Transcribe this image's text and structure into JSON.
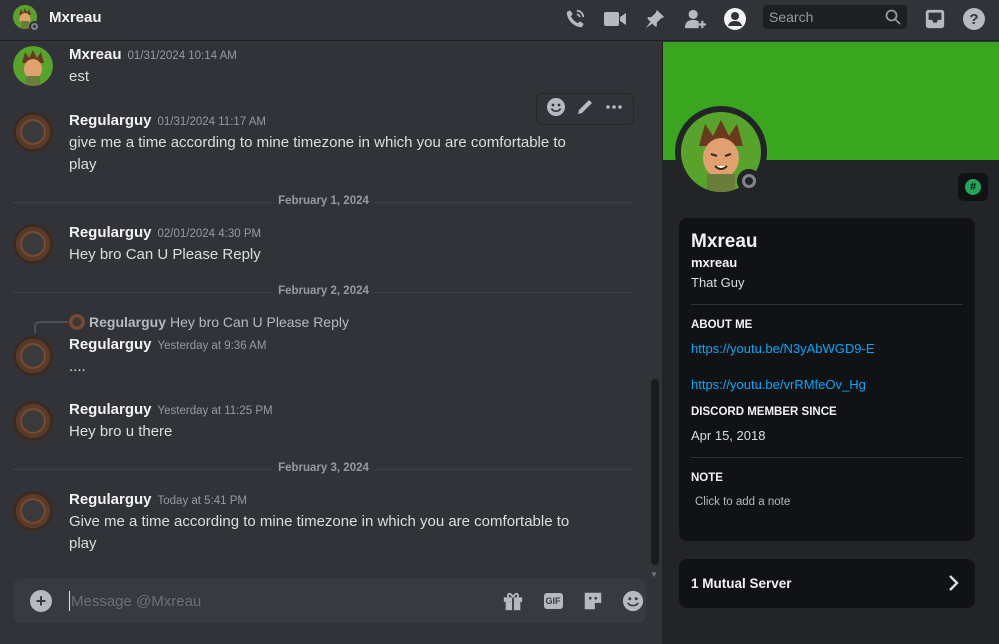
{
  "header": {
    "title": "Mxreau",
    "search_placeholder": "Search"
  },
  "messages": [
    {
      "username": "Mxreau",
      "timestamp": "01/31/2024 10:14 AM",
      "text": "est",
      "avatar": "green-cartoon-avatar"
    },
    {
      "username": "Regularguy",
      "timestamp": "01/31/2024 11:17 AM",
      "text": "give me a time according to mine timezone in which you are comfortable to play",
      "avatar": "dark-circle-avatar"
    },
    {
      "username": "Regularguy",
      "timestamp": "02/01/2024 4:30 PM",
      "text": "Hey bro Can U Please Reply",
      "avatar": "dark-circle-avatar"
    },
    {
      "username": "Regularguy",
      "timestamp": "Yesterday at 9:36 AM",
      "text": "....",
      "avatar": "dark-circle-avatar"
    },
    {
      "username": "Regularguy",
      "timestamp": "Yesterday at 11:25 PM",
      "text": "Hey bro u there",
      "avatar": "dark-circle-avatar"
    },
    {
      "username": "Regularguy",
      "timestamp": "Today at 5:41 PM",
      "text": "Give me a time according to mine timezone in which you are comfortable to play",
      "avatar": "dark-circle-avatar"
    }
  ],
  "dividers": [
    "February 1, 2024",
    "February 2, 2024",
    "February 3, 2024"
  ],
  "reply": {
    "username": "Regularguy",
    "text": "Hey bro Can U Please Reply"
  },
  "composer": {
    "placeholder": "Message @Mxreau",
    "gif_label": "GIF"
  },
  "profile": {
    "display_name": "Mxreau",
    "username": "mxreau",
    "custom_status": "That Guy",
    "about_title": "ABOUT ME",
    "links": [
      "https://youtu.be/N3yAbWGD9-E",
      "https://youtu.be/vrRMfeOv_Hg"
    ],
    "member_since_title": "DISCORD MEMBER SINCE",
    "member_since": "Apr 15, 2018",
    "note_title": "NOTE",
    "note_placeholder": "Click to add a note",
    "mutual_servers": "1 Mutual Server",
    "banner_color": "#3aa51f",
    "badge_icon": "hashtag-badge-icon"
  },
  "colors": {
    "background": "#313338",
    "panel": "#232428",
    "card": "#111214",
    "link": "#00a8fc",
    "banner": "#3aa51f"
  }
}
